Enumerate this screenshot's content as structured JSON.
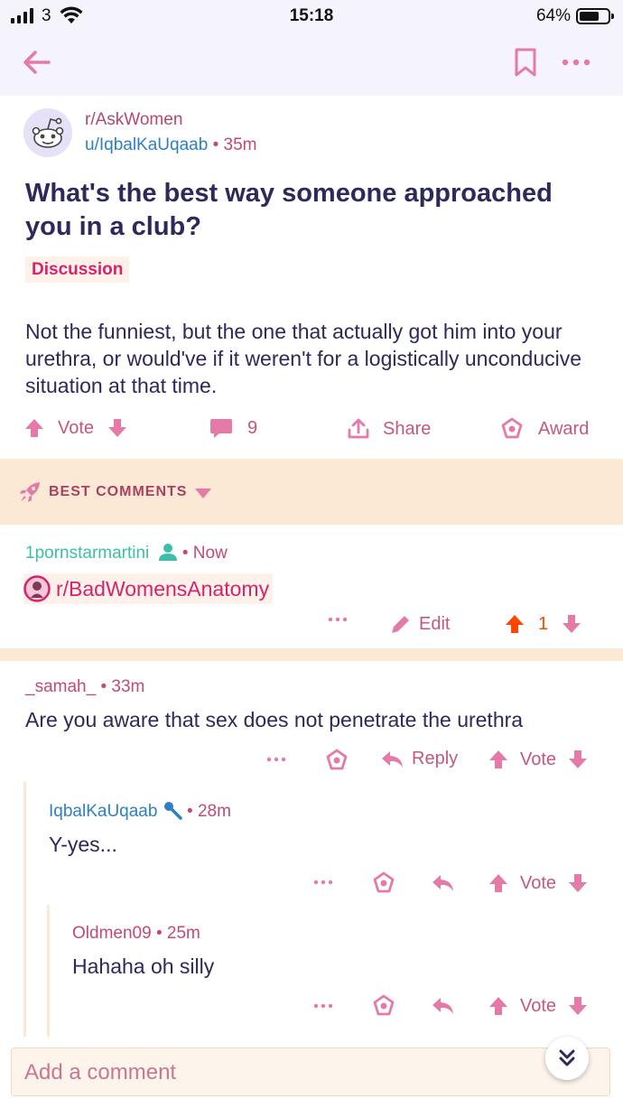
{
  "status_bar": {
    "carrier": "3",
    "time": "15:18",
    "battery": "64%"
  },
  "post": {
    "subreddit": "r/AskWomen",
    "author": "u/IqbalKaUqaab",
    "age": "35m",
    "title": "What's the best way someone approached you in a club?",
    "flair": "Discussion",
    "body": "Not the funniest, but the one that actually got him into your urethra, or would've if it weren't for a logistically unconducive situation at that time.",
    "vote_label": "Vote",
    "comment_count": "9",
    "share_label": "Share",
    "award_label": "Award"
  },
  "best_comments": {
    "label": "BEST COMMENTS"
  },
  "comments": [
    {
      "author": "1pornstarmartini",
      "age": "Now",
      "text": "r/BadWomensAnatomy",
      "edit_label": "Edit",
      "score": "1"
    },
    {
      "author": "_samah_",
      "age": "33m",
      "text": "Are you aware that sex does not penetrate the urethra",
      "reply_label": "Reply",
      "vote_label": "Vote"
    },
    {
      "author": "IqbalKaUqaab",
      "age": "28m",
      "text": "Y-yes...",
      "vote_label": "Vote"
    },
    {
      "author": "Oldmen09",
      "age": "25m",
      "text": "Hahaha oh silly",
      "vote_label": "Vote"
    }
  ],
  "dot_separator": "•",
  "more_dots": "•••",
  "composer": {
    "placeholder": "Add a comment"
  },
  "colors": {
    "accent": "#e57aa9",
    "upvote_active": "#ff4500",
    "background_tint": "#fbe9d6"
  }
}
